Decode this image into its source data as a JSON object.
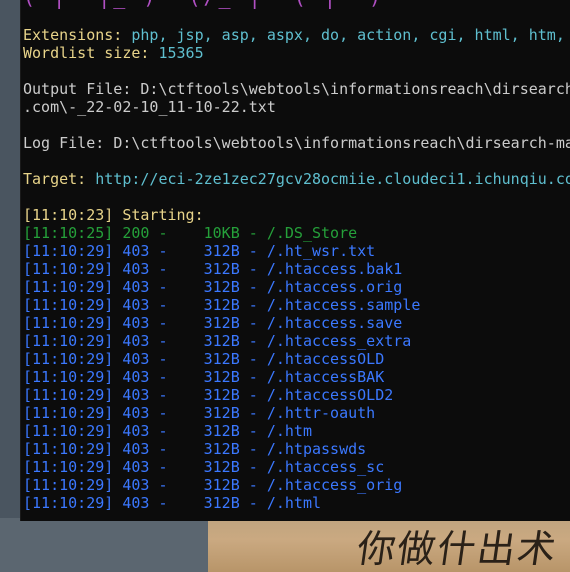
{
  "banner": "( |  |_ )  (/_ |  ( |  )",
  "extensions": {
    "label": "Extensions:",
    "value": "php, jsp, asp, aspx, do, action, cgi, html, htm,"
  },
  "wordlist": {
    "label": "Wordlist size:",
    "value": "15365"
  },
  "output_file": {
    "label": "Output File:",
    "value": "D:\\ctftools\\webtools\\informationsreach\\dirsearch",
    "continuation": ".com\\-_22-02-10_11-10-22.txt"
  },
  "log_file": {
    "label": "Log File:",
    "value": "D:\\ctftools\\webtools\\informationsreach\\dirsearch-ma"
  },
  "target": {
    "label": "Target:",
    "value": "http://eci-2ze1zec27gcv28ocmiie.cloudeci1.ichunqiu.co"
  },
  "starting": "[11:10:23] Starting:",
  "results": [
    {
      "time": "[11:10:25]",
      "code": "200",
      "size": "10KB",
      "path": "/.DS_Store",
      "color": "#25a03a"
    },
    {
      "time": "[11:10:29]",
      "code": "403",
      "size": "312B",
      "path": "/.ht_wsr.txt",
      "color": "#3b78ff"
    },
    {
      "time": "[11:10:29]",
      "code": "403",
      "size": "312B",
      "path": "/.htaccess.bak1",
      "color": "#3b78ff"
    },
    {
      "time": "[11:10:29]",
      "code": "403",
      "size": "312B",
      "path": "/.htaccess.orig",
      "color": "#3b78ff"
    },
    {
      "time": "[11:10:29]",
      "code": "403",
      "size": "312B",
      "path": "/.htaccess.sample",
      "color": "#3b78ff"
    },
    {
      "time": "[11:10:29]",
      "code": "403",
      "size": "312B",
      "path": "/.htaccess.save",
      "color": "#3b78ff"
    },
    {
      "time": "[11:10:29]",
      "code": "403",
      "size": "312B",
      "path": "/.htaccess_extra",
      "color": "#3b78ff"
    },
    {
      "time": "[11:10:29]",
      "code": "403",
      "size": "312B",
      "path": "/.htaccessOLD",
      "color": "#3b78ff"
    },
    {
      "time": "[11:10:29]",
      "code": "403",
      "size": "312B",
      "path": "/.htaccessBAK",
      "color": "#3b78ff"
    },
    {
      "time": "[11:10:29]",
      "code": "403",
      "size": "312B",
      "path": "/.htaccessOLD2",
      "color": "#3b78ff"
    },
    {
      "time": "[11:10:29]",
      "code": "403",
      "size": "312B",
      "path": "/.httr-oauth",
      "color": "#3b78ff"
    },
    {
      "time": "[11:10:29]",
      "code": "403",
      "size": "312B",
      "path": "/.htm",
      "color": "#3b78ff"
    },
    {
      "time": "[11:10:29]",
      "code": "403",
      "size": "312B",
      "path": "/.htpasswds",
      "color": "#3b78ff"
    },
    {
      "time": "[11:10:29]",
      "code": "403",
      "size": "312B",
      "path": "/.htaccess_sc",
      "color": "#3b78ff"
    },
    {
      "time": "[11:10:29]",
      "code": "403",
      "size": "312B",
      "path": "/.htaccess_orig",
      "color": "#3b78ff"
    },
    {
      "time": "[11:10:29]",
      "code": "403",
      "size": "312B",
      "path": "/.html",
      "color": "#3b78ff"
    }
  ],
  "desktop_photo_text": "你做什出术"
}
